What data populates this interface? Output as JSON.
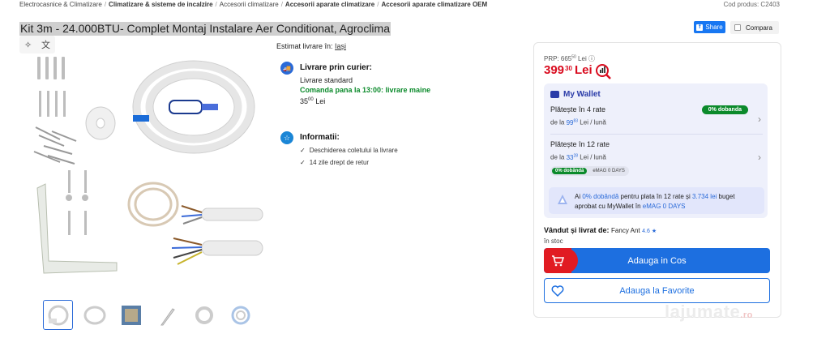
{
  "breadcrumb": {
    "items": [
      "Electrocasnice & Climatizare",
      "Climatizare & sisteme de incalzire",
      "Accesorii climatizare",
      "Accesorii aparate climatizare",
      "Accesorii aparate climatizare OEM"
    ],
    "separator": "/"
  },
  "product_code": "Cod produs: C2403",
  "title": "Kit 3m - 24.000BTU- Complet Montaj Instalare Aer Conditionat, Agroclima",
  "share_label": "Share",
  "compare_label": "Compara",
  "delivery": {
    "estimate_label": "Estimat livrare în:",
    "estimate_city": "Iași",
    "courier_title": "Livrare prin curier:",
    "standard": "Livrare standard",
    "order_note": "Comanda pana la 13:00: livrare maine",
    "price_int": "35",
    "price_dec": "00",
    "currency": "Lei"
  },
  "info": {
    "title": "Informatii:",
    "items": [
      "Deschiderea coletului la livrare",
      "14 zile drept de retur"
    ]
  },
  "pricing": {
    "prp_label": "PRP: 665",
    "prp_dec": "50",
    "prp_currency": "Lei",
    "price_int": "399",
    "price_dec": "30",
    "currency": "Lei"
  },
  "wallet": {
    "title": "My Wallet",
    "plan1_title": "Plătește în 4 rate",
    "plan1_prefix": "de la",
    "plan1_int": "99",
    "plan1_dec": "83",
    "plan1_suffix": "Lei / lună",
    "plan1_badge": "0% dobanda",
    "plan2_title": "Plătește în 12 rate",
    "plan2_prefix": "de la",
    "plan2_int": "33",
    "plan2_dec": "28",
    "plan2_suffix": "Lei / lună",
    "plan2_badge1": "0% dobândă",
    "plan2_badge2": "eMAG 0 DAYS",
    "promo_ai": "Ai",
    "promo_rate": "0% dobândă",
    "promo_mid": "pentru plata în 12 rate și",
    "promo_amount": "3.734 lei",
    "promo_budget": "buget",
    "promo_line2": "aprobat cu MyWallet în",
    "promo_emag": "eMAG 0 DAYS"
  },
  "seller": {
    "label": "Vândut și livrat de:",
    "name": "Fancy Ant",
    "rating": "4.6 ★",
    "stock": "în stoc"
  },
  "actions": {
    "add_to_cart": "Adauga in Cos",
    "add_to_favorites": "Adauga la Favorite"
  },
  "watermark": {
    "brand": "lajumate",
    "tld": ".ro"
  },
  "colors": {
    "price_red": "#d90b1e",
    "primary_blue": "#1d6fe0",
    "success_green": "#0b8a2b",
    "wallet_bg": "#eef0fb"
  }
}
